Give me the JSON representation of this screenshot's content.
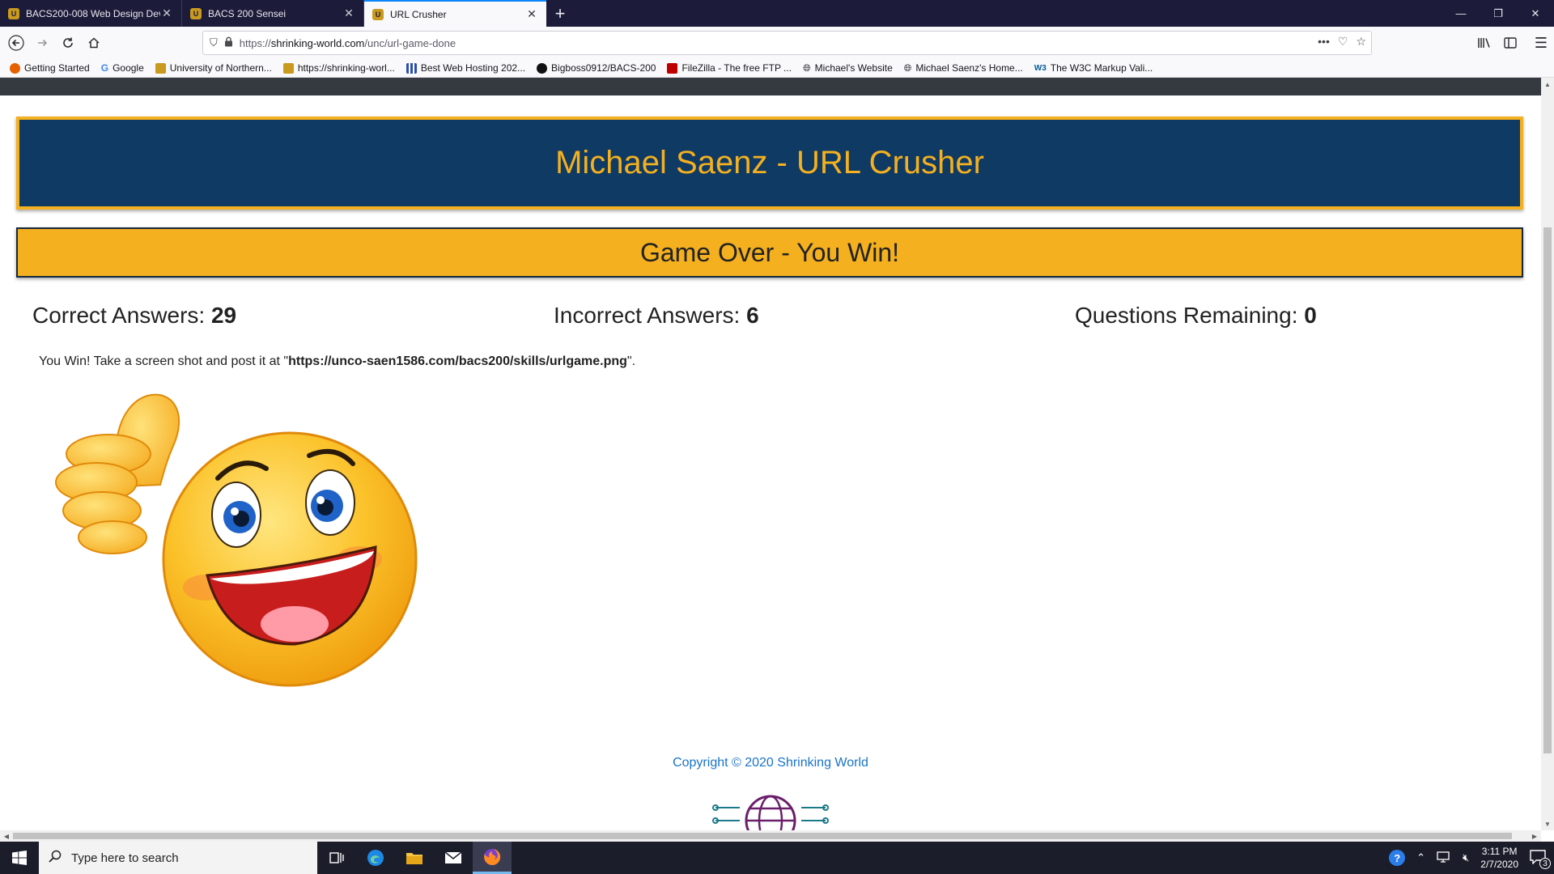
{
  "browser": {
    "tabs": [
      {
        "label": "BACS200-008 Web Design Dev",
        "active": false
      },
      {
        "label": "BACS 200 Sensei",
        "active": false
      },
      {
        "label": "URL Crusher",
        "active": true
      }
    ],
    "url": {
      "scheme": "https://",
      "host": "shrinking-world.com",
      "path": "/unc/url-game-done"
    },
    "bookmarks": [
      {
        "label": "Getting Started",
        "icon": "firefox-icon",
        "color": "#e66000"
      },
      {
        "label": "Google",
        "icon": "google-icon",
        "color": "#4285f4"
      },
      {
        "label": "University of Northern...",
        "icon": "shield-icon",
        "color": "#c99a1e"
      },
      {
        "label": "https://shrinking-worl...",
        "icon": "shield-icon",
        "color": "#c99a1e"
      },
      {
        "label": "Best Web Hosting 202...",
        "icon": "grid-icon",
        "color": "#2b4ea8"
      },
      {
        "label": "Bigboss0912/BACS-200",
        "icon": "github-icon",
        "color": "#111111"
      },
      {
        "label": "FileZilla - The free FTP ...",
        "icon": "filezilla-icon",
        "color": "#bf0000"
      },
      {
        "label": "Michael's Website",
        "icon": "globe-icon",
        "color": "#444444"
      },
      {
        "label": "Michael Saenz's Home...",
        "icon": "globe-icon",
        "color": "#444444"
      },
      {
        "label": "The W3C Markup Vali...",
        "icon": "w3c-icon",
        "color": "#005a9c"
      }
    ]
  },
  "page": {
    "header_title": "Michael Saenz - URL Crusher",
    "banner": "Game Over - You Win!",
    "scores": [
      {
        "label": "Correct Answers:",
        "value": "29"
      },
      {
        "label": "Incorrect Answers:",
        "value": "6"
      },
      {
        "label": "Questions Remaining:",
        "value": "0"
      }
    ],
    "message_before": "You Win! Take a screen shot and post it at \"",
    "message_link": "https://unco-saen1586.com/bacs200/skills/urlgame.png",
    "message_after": "\".",
    "footer": "Copyright © 2020 Shrinking World"
  },
  "taskbar": {
    "search_placeholder": "Type here to search",
    "time": "3:11 PM",
    "date": "2/7/2020",
    "notification_count": "3"
  },
  "colors": {
    "header_bg": "#0f3a64",
    "accent_gold": "#f4b01f",
    "link_blue": "#1a73c9"
  }
}
